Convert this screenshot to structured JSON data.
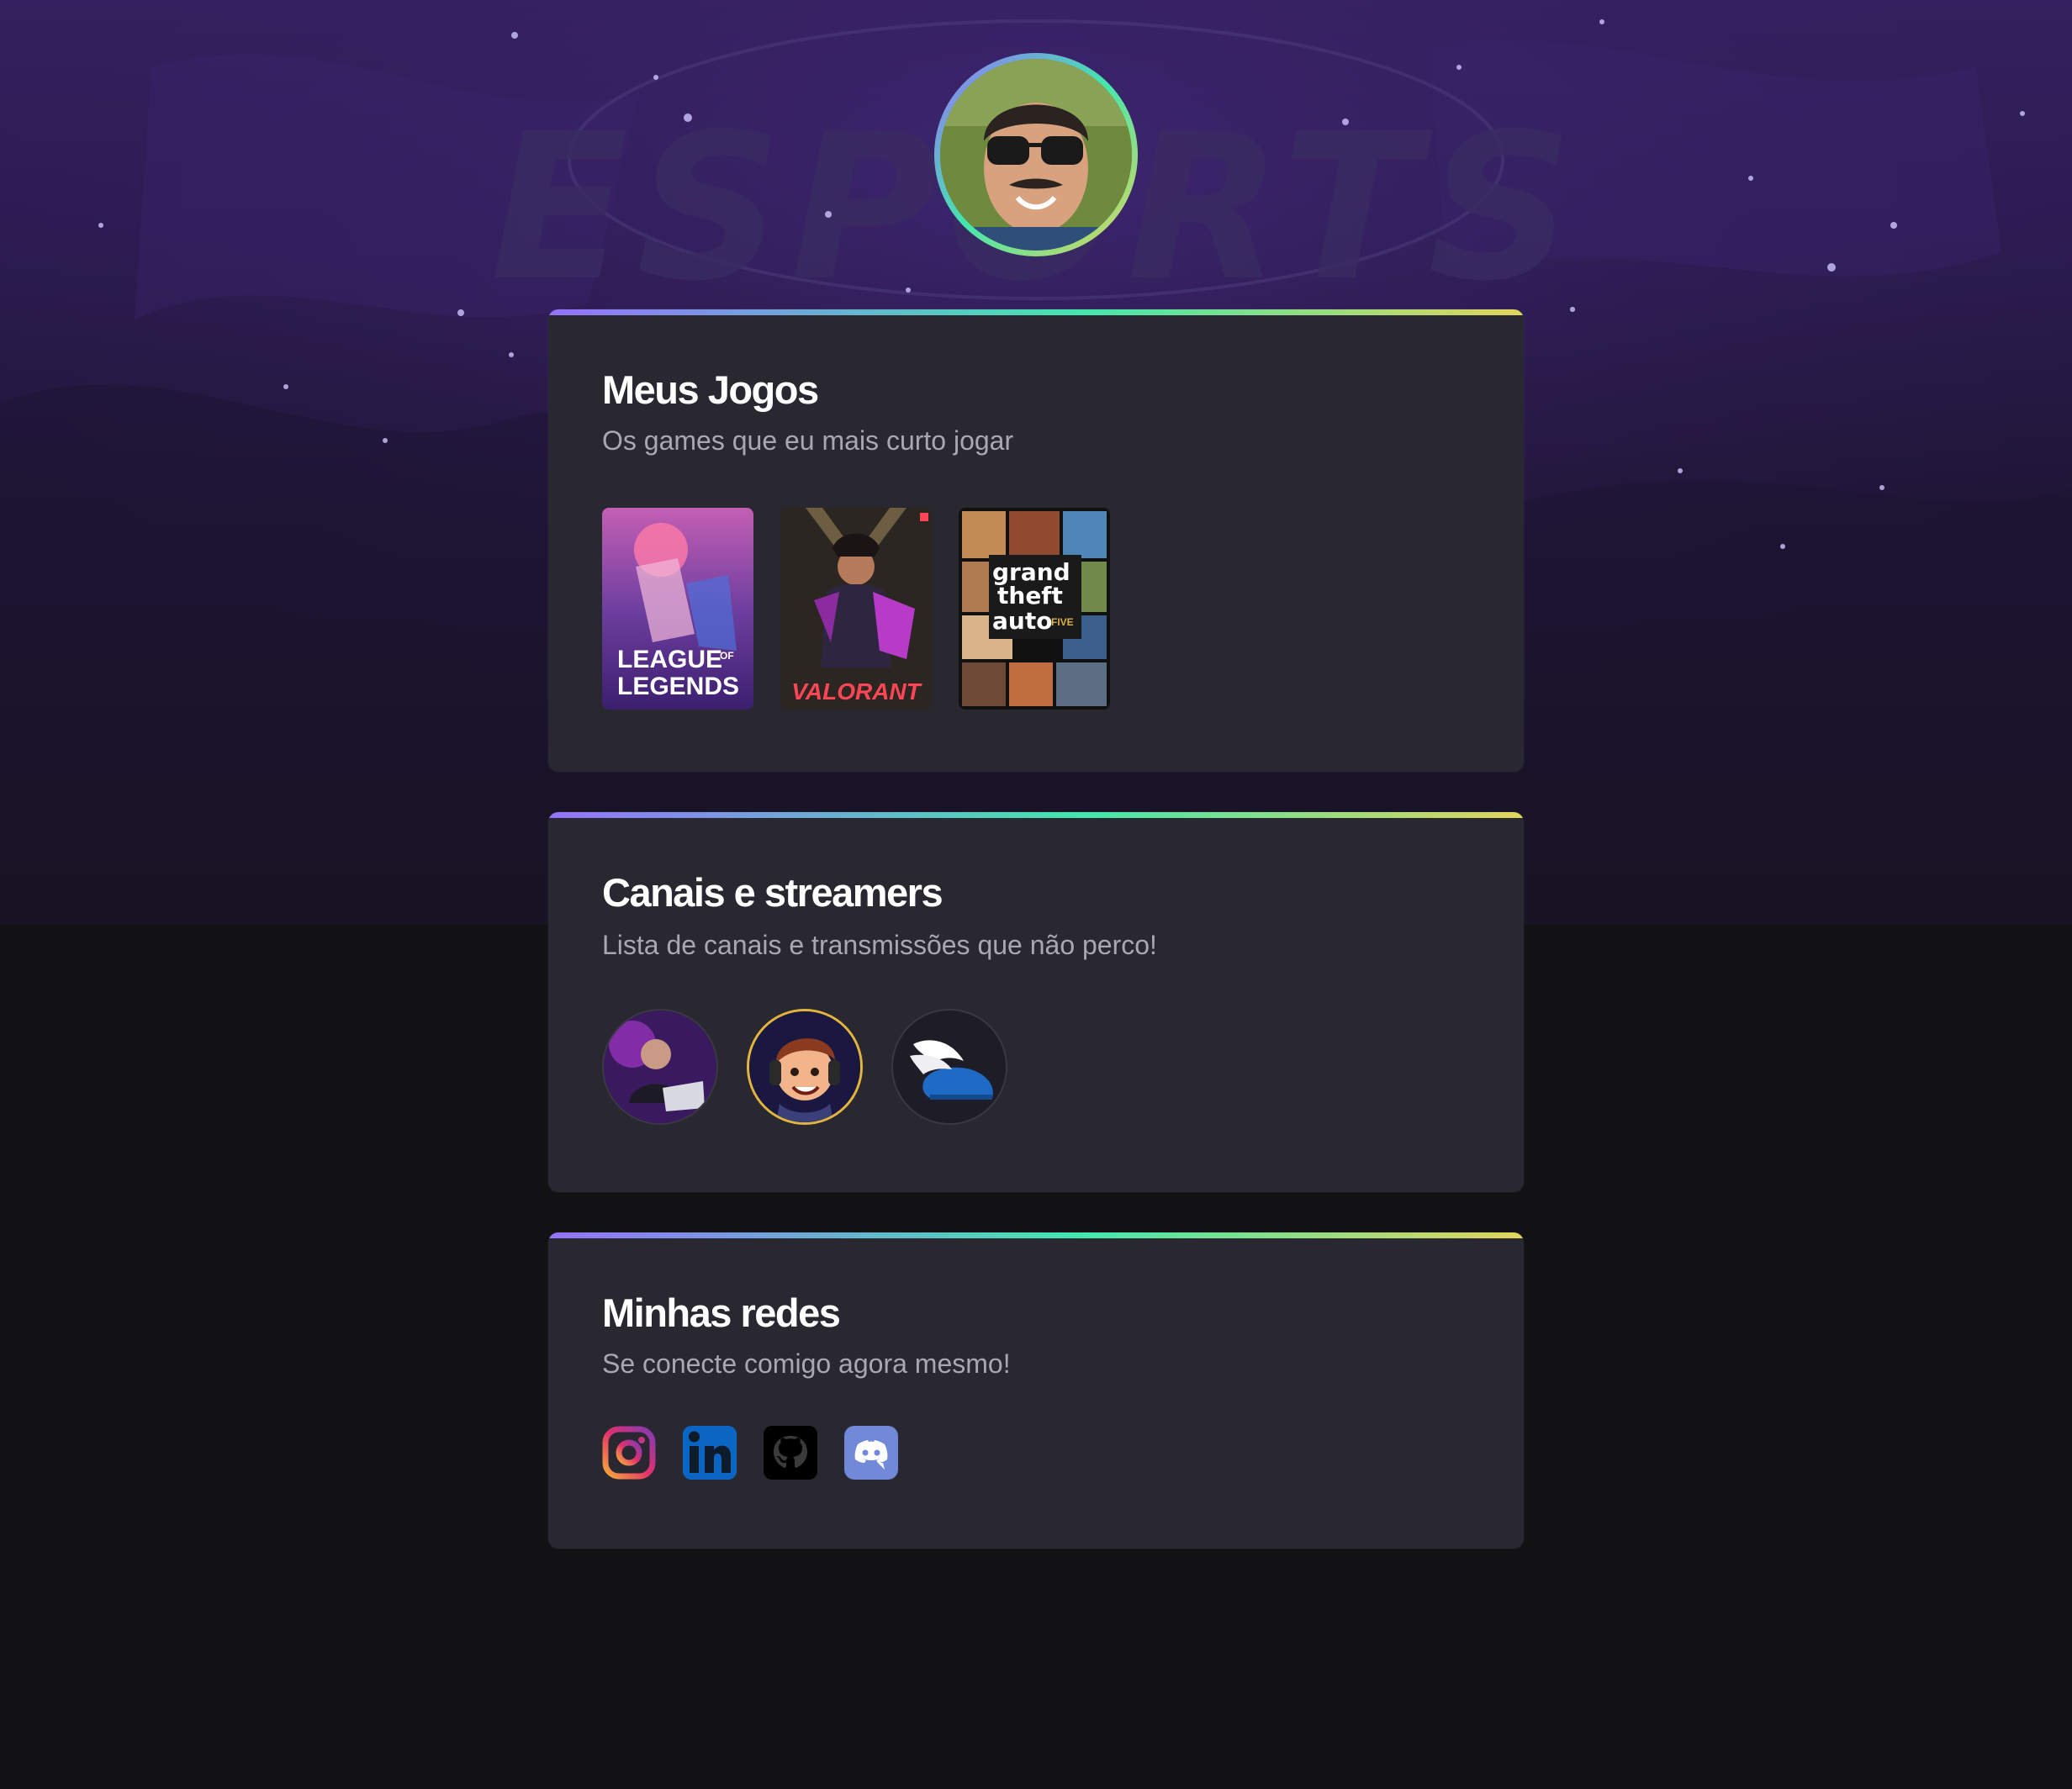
{
  "profile": {
    "avatar_alt": "Foto de perfil"
  },
  "background": {
    "watermark_text": "ESPORTS"
  },
  "games_card": {
    "title": "Meus Jogos",
    "subtitle": "Os games que eu mais curto jogar",
    "games": [
      {
        "name": "League of Legends",
        "line1": "LEAGUE",
        "small": "OF",
        "line2": "LEGENDS"
      },
      {
        "name": "Valorant",
        "logo": "VALORANT"
      },
      {
        "name": "Grand Theft Auto V",
        "line1": "grand",
        "line2": "theft",
        "line3": "auto",
        "badge": "FIVE"
      }
    ]
  },
  "channels_card": {
    "title": "Canais e streamers",
    "subtitle": "Lista de canais e transmissões que não perco!"
  },
  "social_card": {
    "title": "Minhas redes",
    "subtitle": "Se conecte comigo agora mesmo!",
    "networks": [
      "Instagram",
      "LinkedIn",
      "GitHub",
      "Discord"
    ]
  },
  "colors": {
    "page_bg": "#121214",
    "card_bg": "#29272f",
    "gradient": [
      "#9572fc",
      "#43e7ad",
      "#e2d45c"
    ],
    "text_muted": "#a8a8b3"
  }
}
